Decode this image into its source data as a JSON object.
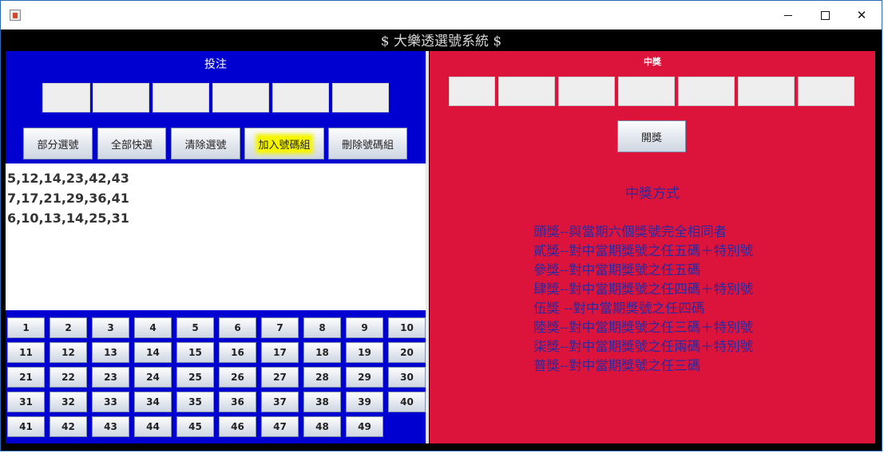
{
  "window": {
    "icon": "java-cup-icon",
    "controls": [
      "minimize-icon",
      "maximize-icon",
      "close-icon"
    ],
    "close_glyph": "✕"
  },
  "header": {
    "title": "$ 大樂透選號系統 $"
  },
  "bet_panel": {
    "title": "投注",
    "slots": [
      "",
      "",
      "",
      "",
      "",
      ""
    ],
    "actions": [
      "部分選號",
      "全部快選",
      "清除選號",
      "加入號碼組",
      "刪除號碼組"
    ],
    "combinations": [
      "5,12,14,23,42,43",
      "7,17,21,29,36,41",
      "6,10,13,14,25,31"
    ],
    "numbers": [
      "1",
      "2",
      "3",
      "4",
      "5",
      "6",
      "7",
      "8",
      "9",
      "10",
      "11",
      "12",
      "13",
      "14",
      "15",
      "16",
      "17",
      "18",
      "19",
      "20",
      "21",
      "22",
      "23",
      "24",
      "25",
      "26",
      "27",
      "28",
      "29",
      "30",
      "31",
      "32",
      "33",
      "34",
      "35",
      "36",
      "37",
      "38",
      "39",
      "40",
      "41",
      "42",
      "43",
      "44",
      "45",
      "46",
      "47",
      "48",
      "49"
    ]
  },
  "prize_panel": {
    "title": "中獎",
    "slots": [
      "",
      "",
      "",
      "",
      "",
      "",
      ""
    ],
    "draw_button": "開獎",
    "rules_title": "中獎方式",
    "rules": [
      "頭獎--與當期六個獎號完全相同者",
      "貳獎--對中當期獎號之任五碼＋特別號",
      "參獎--對中當期獎號之任五碼",
      "肆獎--對中當期獎號之任四碼＋特別號",
      "伍獎 --對中當期獎號之任四碼",
      "陸獎--對中當期獎號之任三碼＋特別號",
      "柒獎--對中當期獎號之任兩碼＋特別號",
      "普獎--對中當期獎號之任三碼"
    ]
  },
  "colors": {
    "bet_panel_bg": "#0000d0",
    "prize_panel_bg": "#dc143c",
    "rules_text": "#2a2aa0",
    "highlight": "#f5f500"
  }
}
